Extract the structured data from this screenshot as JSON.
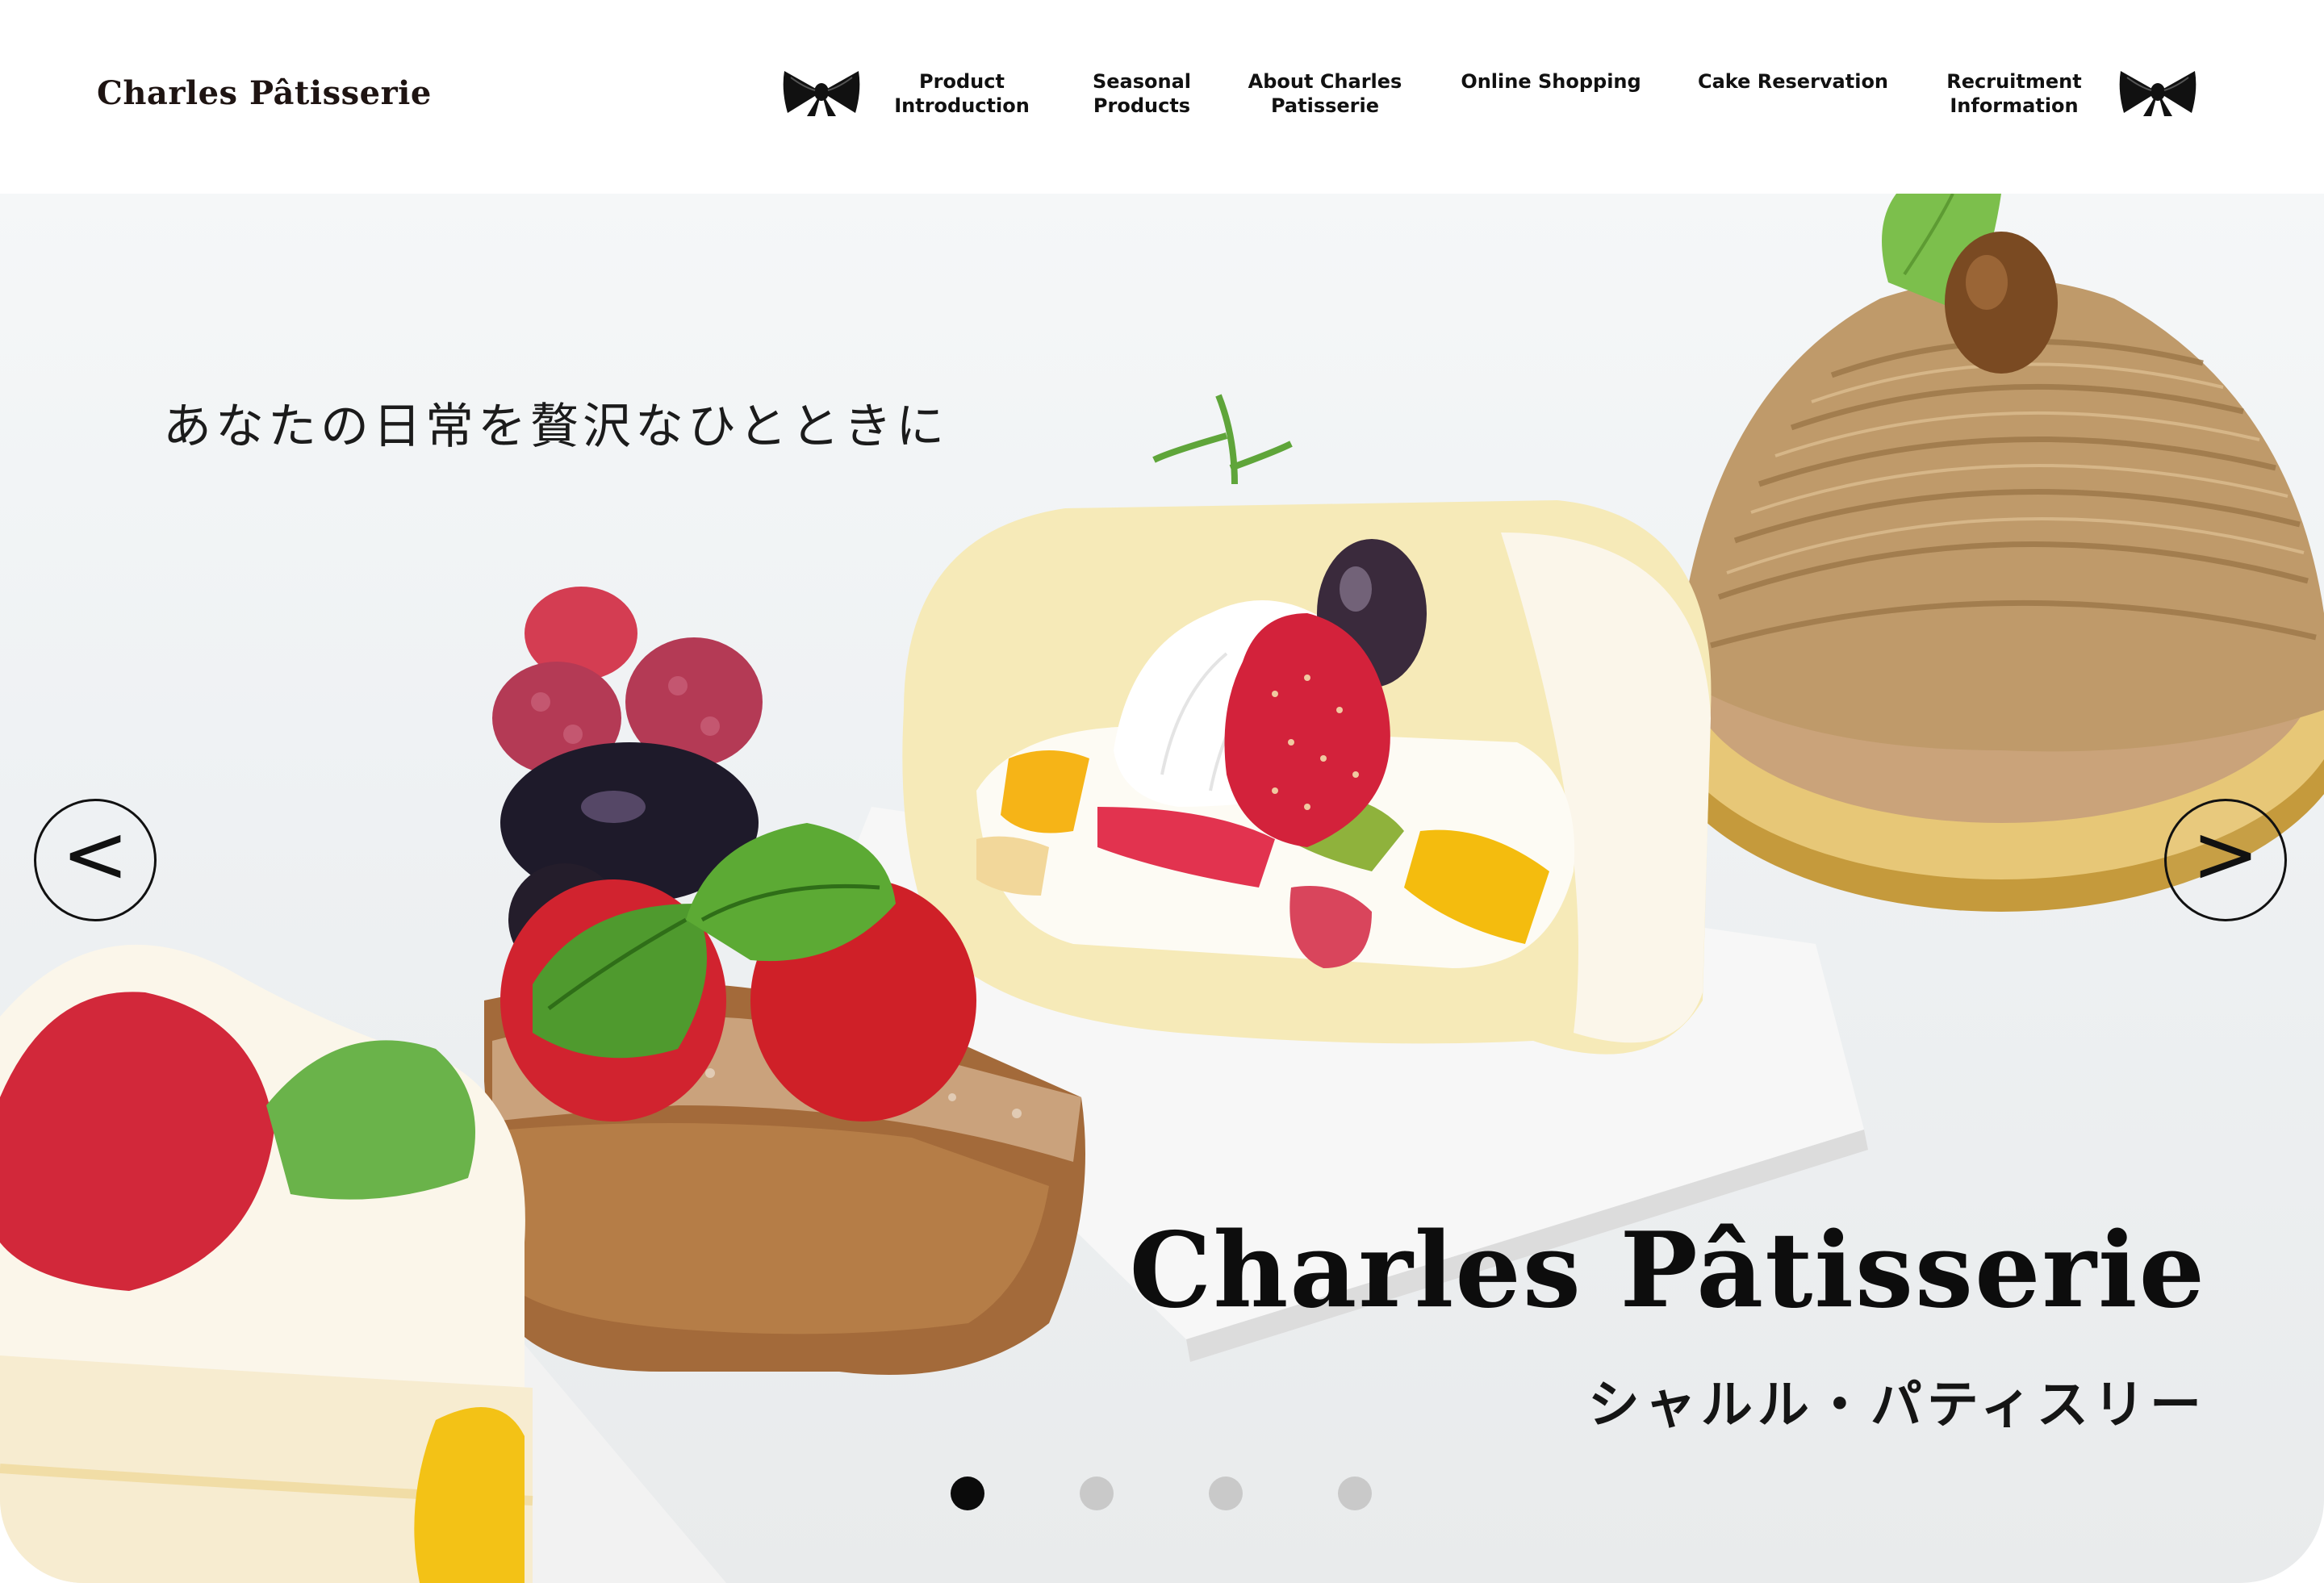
{
  "header": {
    "logo": "Charles Pâtisserie",
    "nav": [
      {
        "line1": "Product",
        "line2": "Introduction"
      },
      {
        "line1": "Seasonal",
        "line2": "Products"
      },
      {
        "line1": "About Charles",
        "line2": "Patisserie"
      },
      {
        "line1": "Online Shopping",
        "line2": ""
      },
      {
        "line1": "Cake Reservation",
        "line2": ""
      },
      {
        "line1": "Recruitment",
        "line2": "Information"
      }
    ]
  },
  "hero": {
    "tagline": "あなたの日常を贅沢なひとときに",
    "title": "Charles Pâtisserie",
    "subtitle": "シャルル・パティスリー",
    "prev_label": "<",
    "next_label": ">",
    "slides_total": 4,
    "active_slide": 1
  },
  "colors": {
    "text": "#111111",
    "dot_active": "#0b0b0b",
    "dot_inactive": "#c9c9c9"
  }
}
